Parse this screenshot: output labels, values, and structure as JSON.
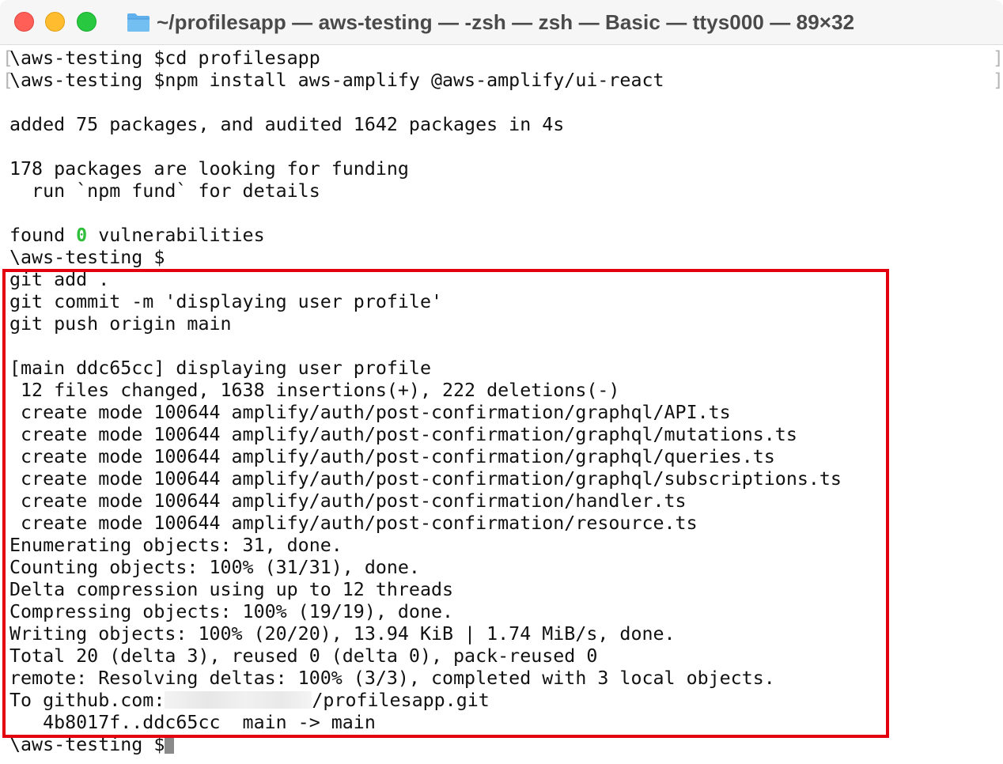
{
  "window": {
    "title": "~/profilesapp — aws-testing — -zsh — zsh — Basic — ttys000 — 89×32",
    "icon": "folder-icon",
    "accent_close": "#ff5f57",
    "accent_minimize": "#febc2e",
    "accent_maximize": "#28c840"
  },
  "terminal": {
    "lines": [
      "\\aws-testing $cd profilesapp",
      "\\aws-testing $npm install aws-amplify @aws-amplify/ui-react",
      "",
      "added 75 packages, and audited 1642 packages in 4s",
      "",
      "178 packages are looking for funding",
      "  run `npm fund` for details",
      "",
      "",
      "\\aws-testing $",
      "git add .",
      "git commit -m 'displaying user profile'",
      "git push origin main",
      "",
      "[main ddc65cc] displaying user profile",
      " 12 files changed, 1638 insertions(+), 222 deletions(-)",
      " create mode 100644 amplify/auth/post-confirmation/graphql/API.ts",
      " create mode 100644 amplify/auth/post-confirmation/graphql/mutations.ts",
      " create mode 100644 amplify/auth/post-confirmation/graphql/queries.ts",
      " create mode 100644 amplify/auth/post-confirmation/graphql/subscriptions.ts",
      " create mode 100644 amplify/auth/post-confirmation/handler.ts",
      " create mode 100644 amplify/auth/post-confirmation/resource.ts",
      "Enumerating objects: 31, done.",
      "Counting objects: 100% (31/31), done.",
      "Delta compression using up to 12 threads",
      "Compressing objects: 100% (19/19), done.",
      "Writing objects: 100% (20/20), 13.94 KiB | 1.74 MiB/s, done.",
      "Total 20 (delta 3), reused 0 (delta 0), pack-reused 0",
      "remote: Resolving deltas: 100% (3/3), completed with 3 local objects.",
      "",
      "   4b8017f..ddc65cc  main -> main",
      "\\aws-testing $"
    ],
    "found_line": {
      "prefix": "found ",
      "count": "0",
      "suffix": " vulnerabilities",
      "count_color": "#2fbf3a"
    },
    "push_line": {
      "prefix": "To github.com:",
      "suffix": "/profilesapp.git"
    },
    "highlight_color": "#e3000f"
  }
}
